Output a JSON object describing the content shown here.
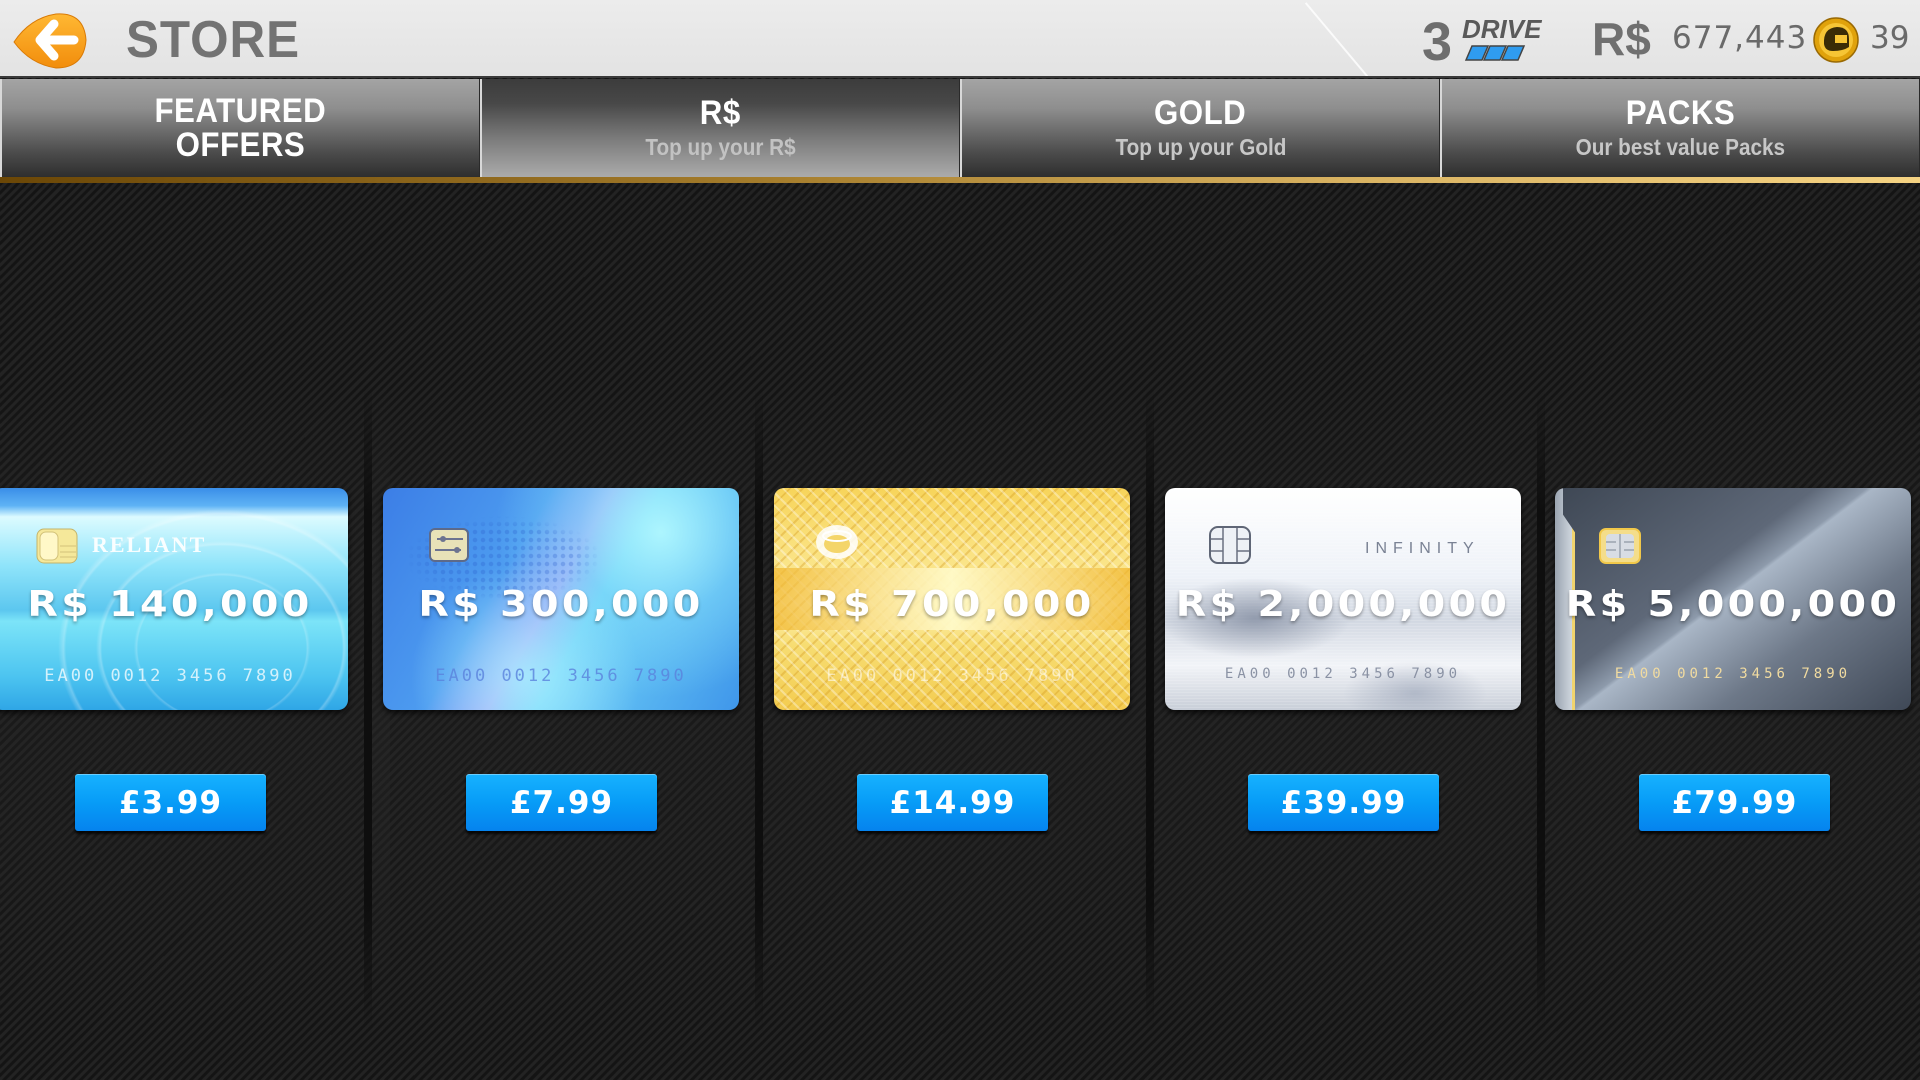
{
  "header": {
    "title": "STORE",
    "back_icon": "arrow-left-icon",
    "brand": {
      "number": "3",
      "word": "DRIVE"
    },
    "currencies": {
      "rs_symbol": "R$",
      "rs_balance": "677,443",
      "gold_icon": "helmet-coin-icon",
      "gold_balance": "39"
    }
  },
  "tabs": [
    {
      "label": "FEATURED",
      "label_line2": "OFFERS",
      "subtitle": "",
      "active": false
    },
    {
      "label": "R$",
      "label_line2": "",
      "subtitle": "Top up your R$",
      "active": true
    },
    {
      "label": "GOLD",
      "label_line2": "",
      "subtitle": "Top up your Gold",
      "active": false
    },
    {
      "label": "PACKS",
      "label_line2": "",
      "subtitle": "Our best value Packs",
      "active": false
    }
  ],
  "offers": [
    {
      "amount": "R$ 140,000",
      "card_brand": "RELIANT",
      "card_number": "EA00 0012 3456 7890",
      "price": "£3.99",
      "style": "blue",
      "accent": "#5cc7ef"
    },
    {
      "amount": "R$ 300,000",
      "card_brand": "",
      "card_number": "EA00 0012 3456 7890",
      "price": "£7.99",
      "style": "world-blue",
      "accent": "#4d9cf0"
    },
    {
      "amount": "R$ 700,000",
      "card_brand": "",
      "card_number": "EA00 0012 3456 7890",
      "price": "£14.99",
      "style": "gold",
      "accent": "#f7d45a"
    },
    {
      "amount": "R$ 2,000,000",
      "card_brand": "INFINITY",
      "card_number": "EA00 0012 3456 7890",
      "price": "£39.99",
      "style": "silver",
      "accent": "#d2d8e2"
    },
    {
      "amount": "R$ 5,000,000",
      "card_brand": "",
      "card_number": "EA00 0012 3456 7890",
      "price": "£79.99",
      "style": "dark-steel",
      "accent": "#5e6878"
    }
  ],
  "colors": {
    "price_button": "#079cf7",
    "gold_rule": "#d8b261",
    "back_button": "#f7a21b"
  }
}
